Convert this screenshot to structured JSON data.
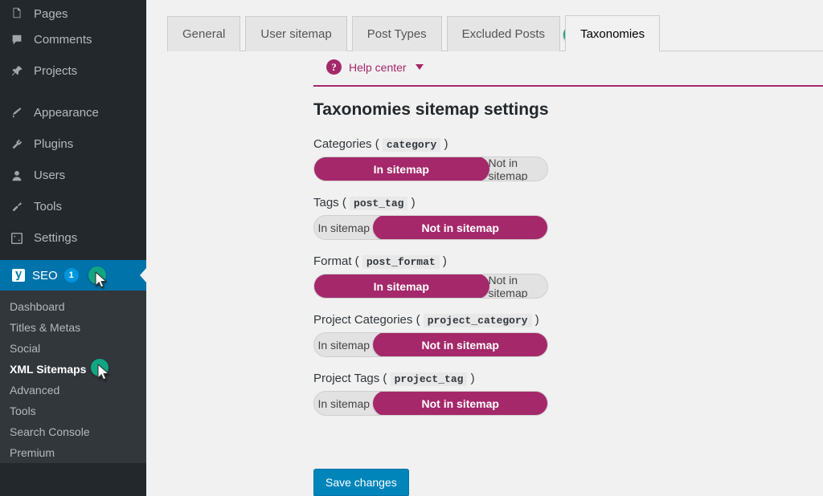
{
  "sidebar": {
    "items": [
      {
        "label": "Pages",
        "icon": "pages-icon"
      },
      {
        "label": "Comments",
        "icon": "comments-icon"
      },
      {
        "label": "Projects",
        "icon": "projects-pin-icon"
      },
      {
        "label": "Appearance",
        "icon": "appearance-brush-icon"
      },
      {
        "label": "Plugins",
        "icon": "plugins-plug-icon"
      },
      {
        "label": "Users",
        "icon": "users-icon"
      },
      {
        "label": "Tools",
        "icon": "tools-wrench-icon"
      },
      {
        "label": "Settings",
        "icon": "settings-sliders-icon"
      }
    ],
    "seo": {
      "label": "SEO",
      "badge": "1",
      "icon": "yoast-logo-icon",
      "highlight_color": "#0073aa"
    },
    "submenu": [
      {
        "label": "Dashboard",
        "current": false
      },
      {
        "label": "Titles & Metas",
        "current": false
      },
      {
        "label": "Social",
        "current": false
      },
      {
        "label": "XML Sitemaps",
        "current": true
      },
      {
        "label": "Advanced",
        "current": false
      },
      {
        "label": "Tools",
        "current": false
      },
      {
        "label": "Search Console",
        "current": false
      },
      {
        "label": "Premium",
        "current": false
      }
    ],
    "cursor_color": "#11a683"
  },
  "tabs": [
    {
      "label": "General",
      "active": false
    },
    {
      "label": "User sitemap",
      "active": false
    },
    {
      "label": "Post Types",
      "active": false
    },
    {
      "label": "Excluded Posts",
      "active": false
    },
    {
      "label": "Taxonomies",
      "active": true
    }
  ],
  "help_center": {
    "label": "Help center",
    "icon": "question-mark-icon",
    "caret": "chevron-down-icon",
    "color": "#a4286a"
  },
  "main": {
    "title": "Taxonomies sitemap settings",
    "options": {
      "in": "In sitemap",
      "out": "Not in sitemap"
    },
    "fields": [
      {
        "name": "Categories",
        "slug": "category",
        "value": "in"
      },
      {
        "name": "Tags",
        "slug": "post_tag",
        "value": "out"
      },
      {
        "name": "Format",
        "slug": "post_format",
        "value": "in"
      },
      {
        "name": "Project Categories",
        "slug": "project_category",
        "value": "out"
      },
      {
        "name": "Project Tags",
        "slug": "project_tag",
        "value": "out"
      }
    ],
    "save_label": "Save changes",
    "save_color": "#0085ba",
    "active_color": "#a4286a"
  }
}
